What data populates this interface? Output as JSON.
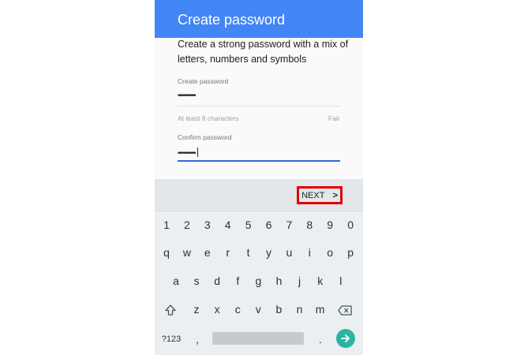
{
  "app_bar": {
    "title": "Create password"
  },
  "form": {
    "description": "Create a strong password with a mix of letters, numbers and symbols",
    "create_label": "Create password",
    "create_value": "•••••••••",
    "hint": "At least 8 characters",
    "strength": "Fair",
    "confirm_label": "Confirm password",
    "confirm_value": "•••••••••"
  },
  "keyboard": {
    "next_label": "NEXT",
    "row_numbers": [
      "1",
      "2",
      "3",
      "4",
      "5",
      "6",
      "7",
      "8",
      "9",
      "0"
    ],
    "row_top": [
      "q",
      "w",
      "e",
      "r",
      "t",
      "y",
      "u",
      "i",
      "o",
      "p"
    ],
    "row_middle": [
      "a",
      "s",
      "d",
      "f",
      "g",
      "h",
      "j",
      "k",
      "l"
    ],
    "row_bottom": [
      "z",
      "x",
      "c",
      "v",
      "b",
      "n",
      "m"
    ],
    "symbols_label": "?123",
    "comma": ",",
    "period": "."
  },
  "colors": {
    "app_bar": "#4285f4",
    "field_active": "#3367d6",
    "highlight_box": "#e00000",
    "go_button": "#2bb5a1"
  },
  "icons": {
    "shift": "shift-icon",
    "backspace": "backspace-icon",
    "next": "chevron-right-icon",
    "go": "arrow-right-icon"
  }
}
